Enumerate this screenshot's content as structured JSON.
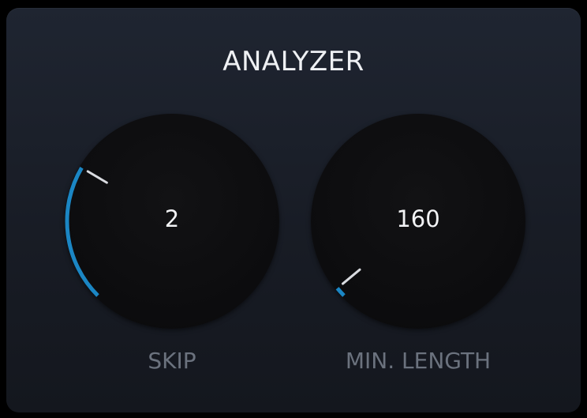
{
  "title": "ANALYZER",
  "colors": {
    "accent": "#1b86c4",
    "indicator": "#d9dbe0",
    "label": "#6b727e"
  },
  "knobs": {
    "skip": {
      "value": "2",
      "label": "SKIP",
      "normalized": 0.28
    },
    "min_length": {
      "value": "160",
      "label": "MIN. LENGTH",
      "normalized": 0.02
    }
  }
}
